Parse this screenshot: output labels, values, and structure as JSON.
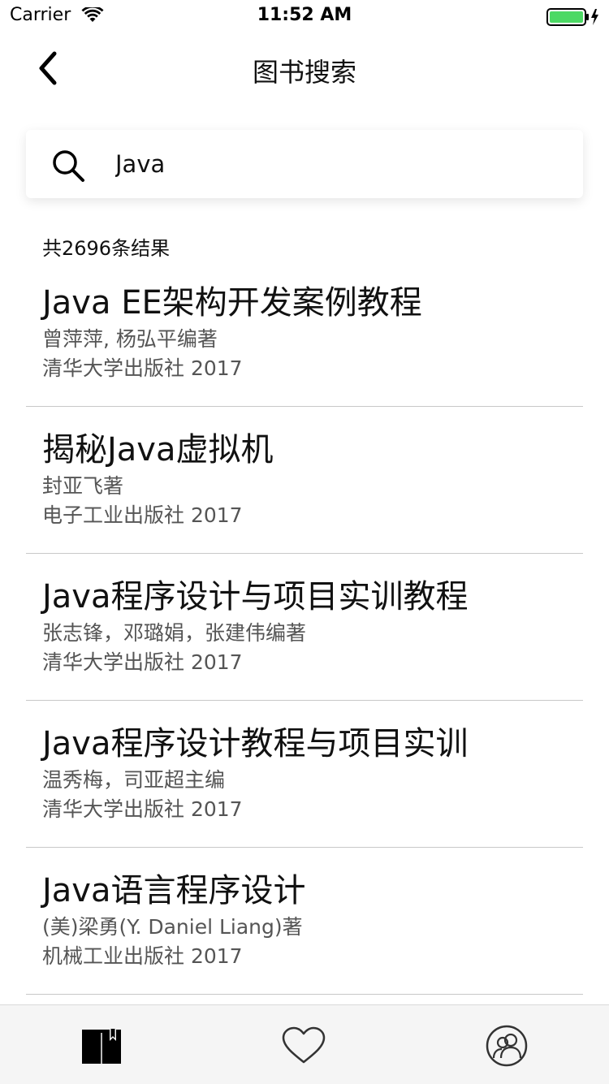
{
  "status_bar": {
    "carrier": "Carrier",
    "time": "11:52 AM",
    "battery_color": "#4cd964"
  },
  "nav": {
    "title": "图书搜索",
    "back_icon": "chevron-left-icon"
  },
  "search": {
    "value": "Java",
    "icon": "search-icon"
  },
  "results": {
    "count_text": "共2696条结果",
    "items": [
      {
        "title": "Java EE架构开发案例教程",
        "author": "曾萍萍, 杨弘平编著",
        "publisher": "清华大学出版社 2017"
      },
      {
        "title": "揭秘Java虚拟机",
        "author": "封亚飞著",
        "publisher": "电子工业出版社 2017"
      },
      {
        "title": "Java程序设计与项目实训教程",
        "author": "张志锋，邓璐娟，张建伟编著",
        "publisher": "清华大学出版社 2017"
      },
      {
        "title": "Java程序设计教程与项目实训",
        "author": "温秀梅，司亚超主编",
        "publisher": "清华大学出版社 2017"
      },
      {
        "title": "Java语言程序设计",
        "author": "(美)梁勇(Y. Daniel Liang)著",
        "publisher": "机械工业出版社 2017"
      }
    ]
  },
  "tab_bar": {
    "tabs": [
      {
        "icon": "book-icon",
        "active": true
      },
      {
        "icon": "heart-icon",
        "active": false
      },
      {
        "icon": "users-icon",
        "active": false
      }
    ]
  }
}
